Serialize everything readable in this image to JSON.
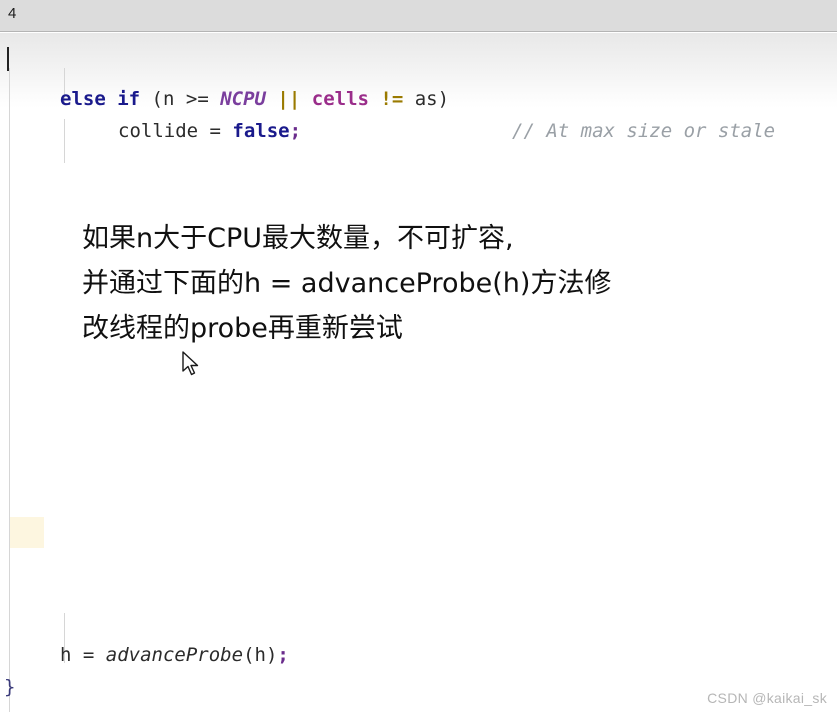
{
  "topbar": {
    "label": "4"
  },
  "editor": {
    "caret_visible": true,
    "code_lines": [
      {
        "id": "line1",
        "tokens": "else if (n >= NCPU || cells != as)"
      },
      {
        "id": "line2",
        "tokens": "collide = false;"
      },
      {
        "id": "line4",
        "tokens": "h = advanceProbe(h);"
      },
      {
        "id": "line5",
        "tokens": "}"
      }
    ],
    "code": {
      "kw_else": "else",
      "kw_if": "if",
      "paren_open": " (",
      "var_n": "n",
      "op_ge": " >= ",
      "field_ncpu": "NCPU",
      "op_or": " || ",
      "ident_cells": "cells",
      "op_ne": " != ",
      "var_as": "as",
      "paren_close": ")",
      "var_collide": "collide",
      "op_assign": " = ",
      "kw_false": "false",
      "semicolon": ";",
      "var_h": "h",
      "method_advanceprobe": "advanceProbe",
      "call_args": "(h)",
      "closing_brace": "}"
    },
    "comment": "// At max size or stale",
    "highlight_block_color": "#fdf6e0"
  },
  "annotation": {
    "line1": "如果n大于CPU最大数量，不可扩容,",
    "line2": "并通过下面的h = advanceProbe(h)方法修",
    "line3": "改线程的probe再重新尝试"
  },
  "cursor": {
    "type": "arrow-pointer"
  },
  "watermark": {
    "text": "CSDN @kaikai_sk"
  },
  "colors": {
    "keyword": "#1a1a8c",
    "field": "#7a3e9d",
    "identifier": "#9a2d8a",
    "operator": "#9a7a00",
    "comment": "#9aa0a6",
    "topbar_bg": "#dcdcdc",
    "highlight": "#fdf6e0",
    "watermark": "#b6b6b6"
  }
}
